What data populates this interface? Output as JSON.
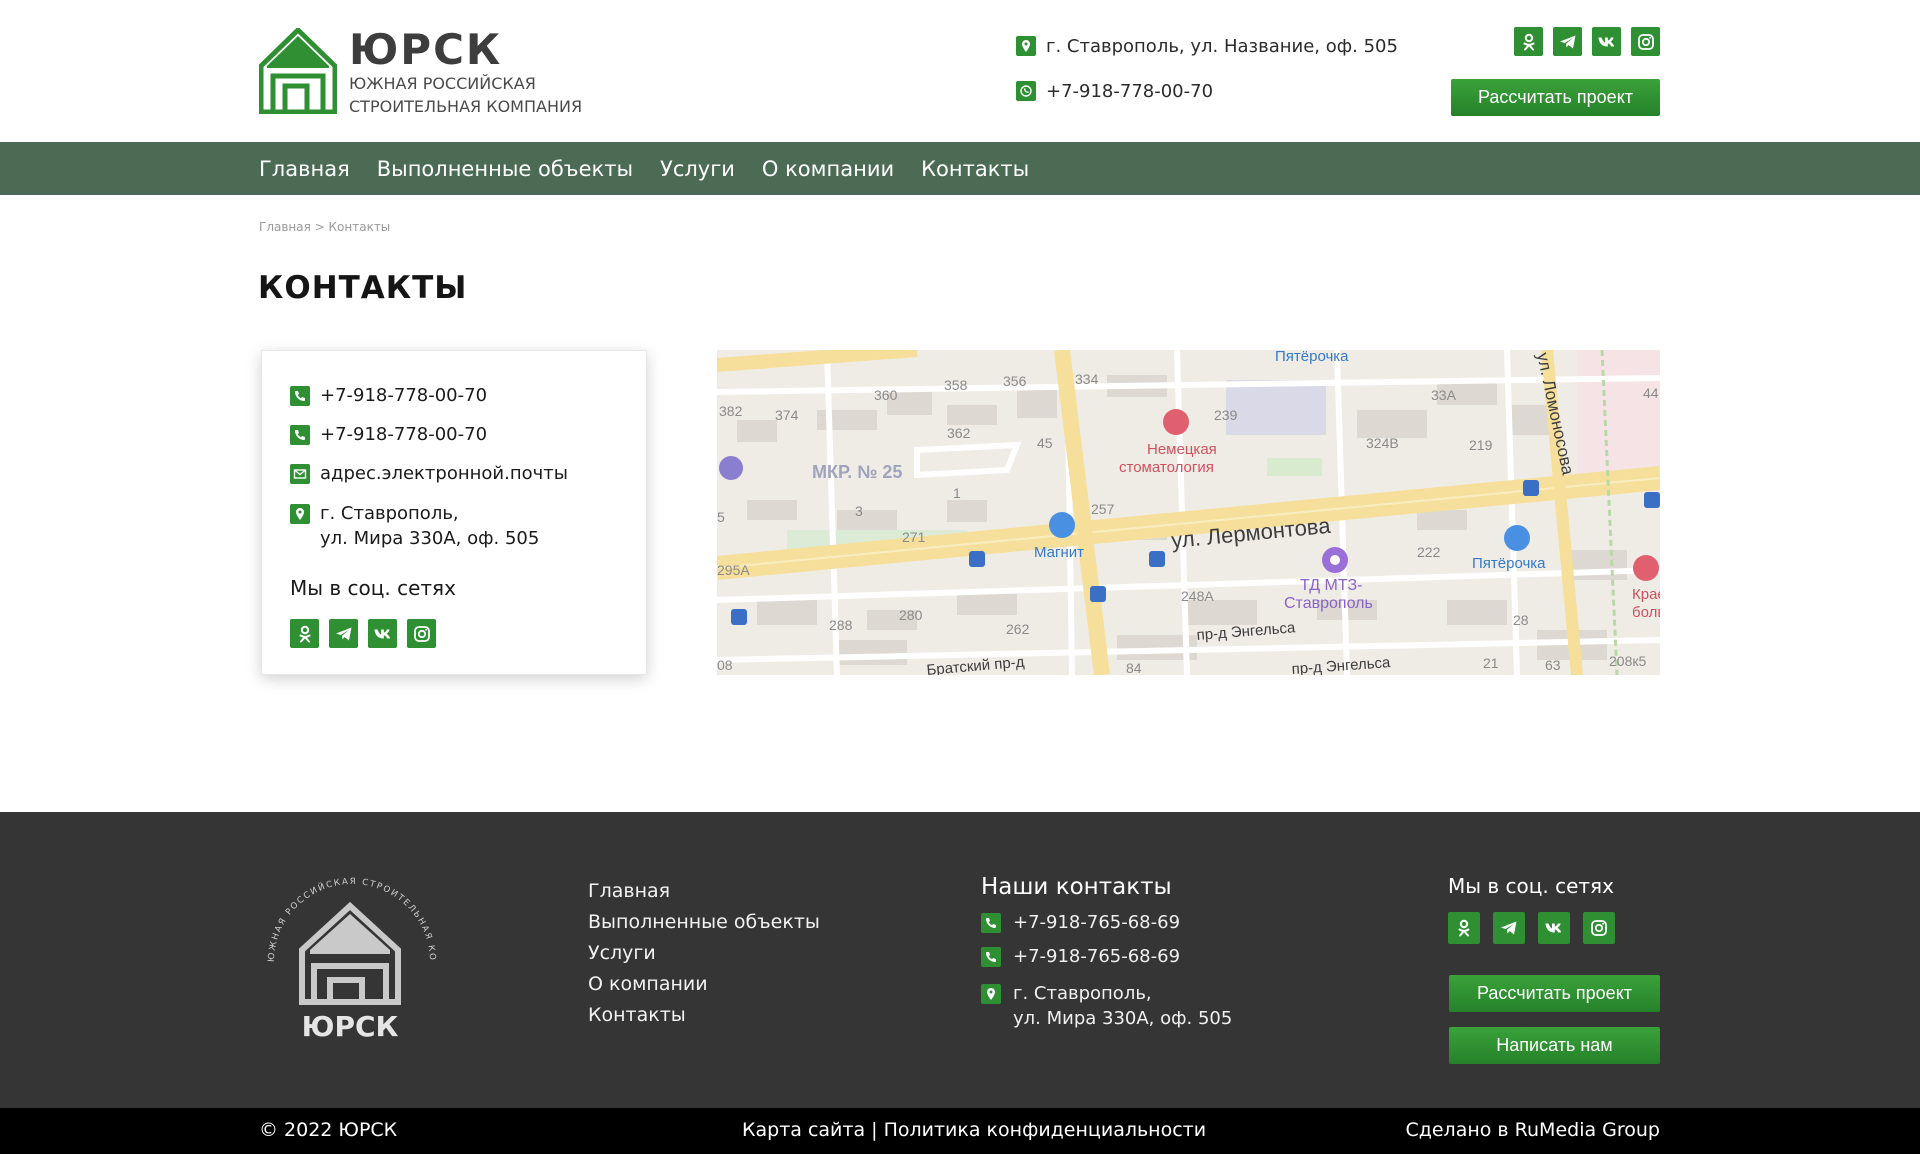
{
  "header": {
    "logo_name": "ЮРСК",
    "logo_sub_1": "ЮЖНАЯ РОССИЙСКАЯ",
    "logo_sub_2": "СТРОИТЕЛЬНАЯ КОМПАНИЯ",
    "address": "г. Ставрополь, ул. Название, оф. 505",
    "phone": "+7-918-778-00-70",
    "cta": "Рассчитать проект"
  },
  "nav": [
    "Главная",
    "Выполненные объекты",
    "Услуги",
    "О компании",
    "Контакты"
  ],
  "breadcrumb": "Главная > Контакты",
  "page_title": "КОНТАКТЫ",
  "card": {
    "phone_1": "+7-918-778-00-70",
    "phone_2": "+7-918-778-00-70",
    "email": "адрес.электронной.почты",
    "address_1": "г. Ставрополь,",
    "address_2": "ул. Мира 330А, оф. 505",
    "social_title": "Мы в соц. сетях"
  },
  "map": {
    "street_main": "ул. Лермонтова",
    "street_engels_1": "пр-д Энгельса",
    "street_engels_2": "пр-д Энгельса",
    "street_bratsky": "Братский пр-д",
    "street_lomonosova": "ул. Ломоносова",
    "district": "МКР. № 25",
    "poi_magnit": "Магнит",
    "poi_pyaterochka_top": "Пятёрочка",
    "poi_pyaterochka": "Пятёрочка",
    "poi_dental_1": "Немецкая",
    "poi_dental_2": "стоматология",
    "poi_mall_1": "ТД МТЗ-",
    "poi_mall_2": "Ставрополь",
    "poi_hospital_1": "Краев",
    "poi_hospital_2": "больн",
    "buildings": [
      "382",
      "374",
      "360",
      "358",
      "356",
      "334",
      "362",
      "45",
      "239",
      "33А",
      "44",
      "324В",
      "219",
      "1",
      "3",
      "257",
      "271",
      "295А",
      "222",
      "248А",
      "280",
      "288",
      "262",
      "28",
      "84",
      "21",
      "63",
      "208к5",
      "08",
      "5"
    ]
  },
  "footer": {
    "logo_name": "ЮРСК",
    "logo_ring": "ЮЖНАЯ РОССИЙСКАЯ СТРОИТЕЛЬНАЯ КОМПАНИЯ",
    "menu": [
      "Главная",
      "Выполненные объекты",
      "Услуги",
      "О компании",
      "Контакты"
    ],
    "contacts_title": "Наши контакты",
    "phone_1": "+7-918-765-68-69",
    "phone_2": "+7-918-765-68-69",
    "address_1": "г. Ставрополь,",
    "address_2": "ул. Мира 330А, оф. 505",
    "social_title": "Мы в соц. сетях",
    "btn_calc": "Рассчитать проект",
    "btn_write": "Написать нам"
  },
  "bottom": {
    "copyright": "© 2022 ЮРСК",
    "links": "Карта сайта | Политика конфиденциальности",
    "made_by": "Сделано в RuMedia Group"
  },
  "colors": {
    "accent_green": "#2f8f33",
    "nav_bg": "#4c6b54",
    "footer_bg": "#353535",
    "bottom_bg": "#000000"
  },
  "icons": {
    "social": [
      "odnoklassniki-icon",
      "telegram-icon",
      "vk-icon",
      "instagram-icon"
    ],
    "contact": [
      "map-pin-icon",
      "whatsapp-icon",
      "phone-icon",
      "mail-icon"
    ]
  }
}
